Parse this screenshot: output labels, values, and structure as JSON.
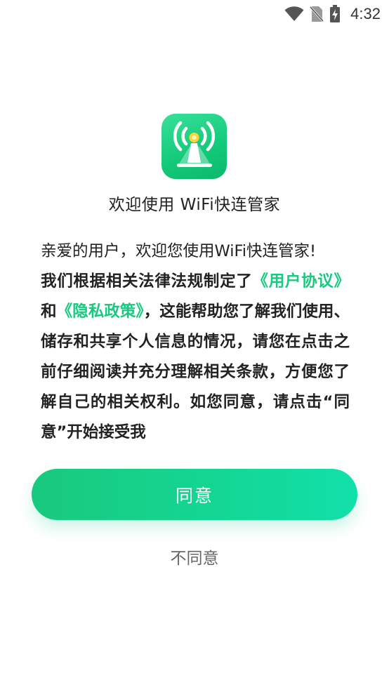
{
  "status_bar": {
    "time": "4:32",
    "icons": [
      "wifi-signal-icon",
      "no-sim-icon",
      "battery-charging-icon"
    ]
  },
  "app": {
    "icon": "wifi-tower-icon",
    "welcome_title": "欢迎使用 WiFi快连管家"
  },
  "terms": {
    "intro": "亲爱的用户，欢迎您使用WiFi快连管家!",
    "part1": "我们根据相关法律法规制定了",
    "user_agreement_link": "《用户协议》",
    "conj": "和",
    "privacy_policy_link": "《隐私政策》",
    "part2": "，这能帮助您了解我们使用、储存和共享个人信息的情况，请您在点击之前仔细阅读并充分理解相关条款，方便您了解自己的相关权利。如您同意，请点击“同意”开始接受我"
  },
  "buttons": {
    "agree_label": "同意",
    "disagree_label": "不同意"
  },
  "colors": {
    "accent": "#18c97f",
    "button_gradient_start": "#19c97d",
    "button_gradient_end": "#12e0aa"
  }
}
